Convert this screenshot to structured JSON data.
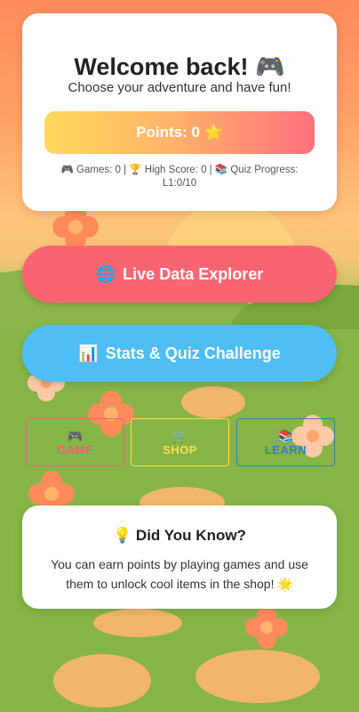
{
  "welcome": {
    "title": "Welcome back! 🎮",
    "subtitle": "Choose your adventure and have fun!",
    "points_label": "Points: 0 ⭐",
    "stats_line": "🎮 Games: 0 | 🏆 High Score: 0 | 📚 Quiz Progress: L1:0/10"
  },
  "actions": {
    "explorer": {
      "icon": "🌐",
      "label": "Live Data Explorer"
    },
    "quiz": {
      "icon": "📊",
      "label": "Stats & Quiz Challenge"
    }
  },
  "nav": {
    "game": {
      "icon": "🎮",
      "label": "GAME"
    },
    "shop": {
      "icon": "🛒",
      "label": "SHOP"
    },
    "learn": {
      "icon": "📚",
      "label": "LEARN"
    }
  },
  "fact": {
    "title": "💡 Did You Know?",
    "text": "You can earn points by playing games and use them to unlock cool items in the shop! 🌟"
  },
  "colors": {
    "explorer": "#fb6573",
    "quiz": "#4fbef5",
    "game_border": "#e8627a",
    "shop_border": "#ffe04a",
    "learn_border": "#2d7fc7"
  }
}
